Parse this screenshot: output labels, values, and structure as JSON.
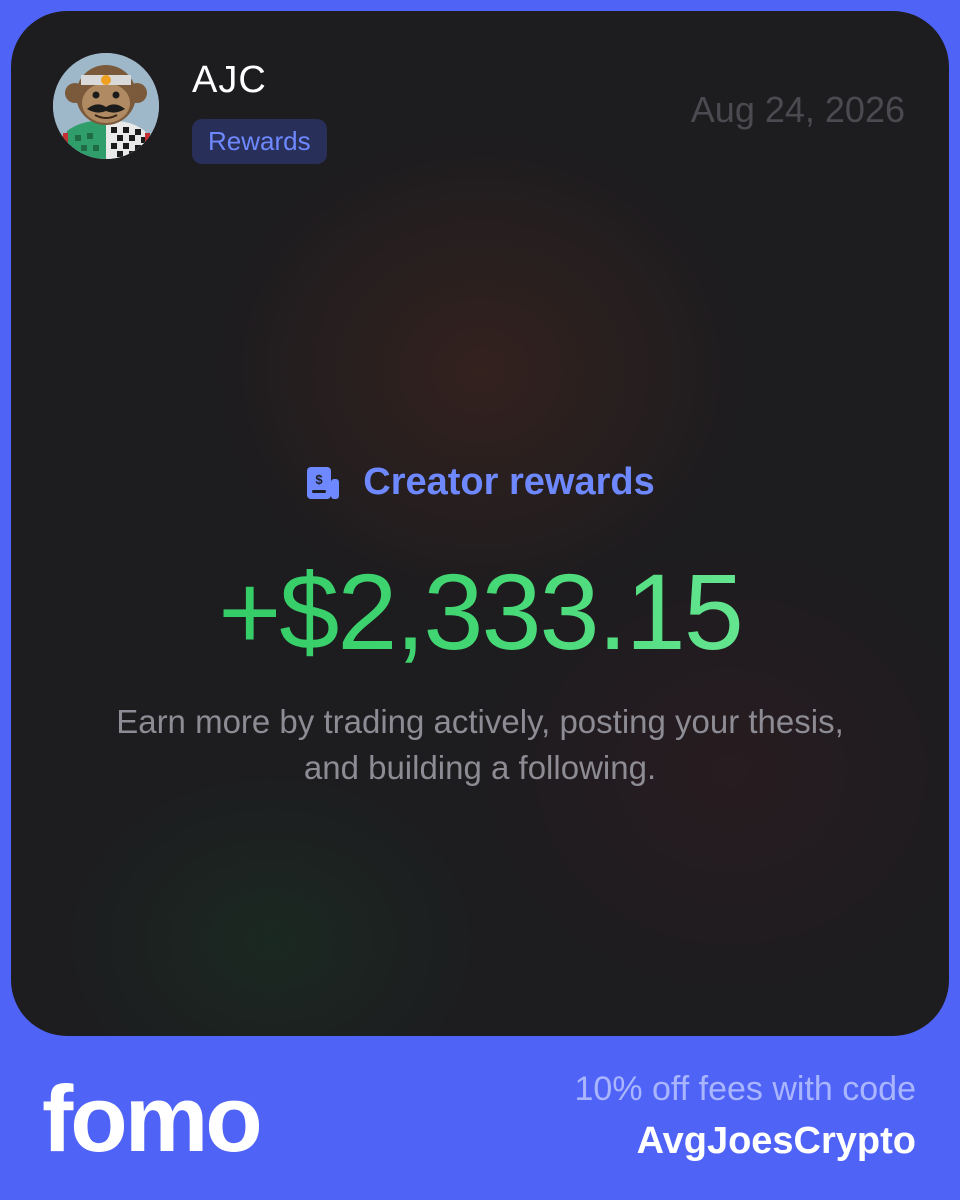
{
  "header": {
    "user_name": "AJC",
    "badge_label": "Rewards",
    "date": "Aug 24, 2026",
    "avatar_icon": "monkey-avatar"
  },
  "main": {
    "rewards_icon": "receipt-dollar-icon",
    "rewards_label": "Creator rewards",
    "amount": "+$2,333.15",
    "description": "Earn more by trading actively, posting your thesis, and building a following."
  },
  "footer": {
    "brand": "fomo",
    "promo_line": "10% off fees with code",
    "promo_code": "AvgJoesCrypto"
  },
  "colors": {
    "background": "#4f63f7",
    "card": "#1d1c1f",
    "accent": "#6e88ff",
    "amount_green": "#43d774"
  }
}
